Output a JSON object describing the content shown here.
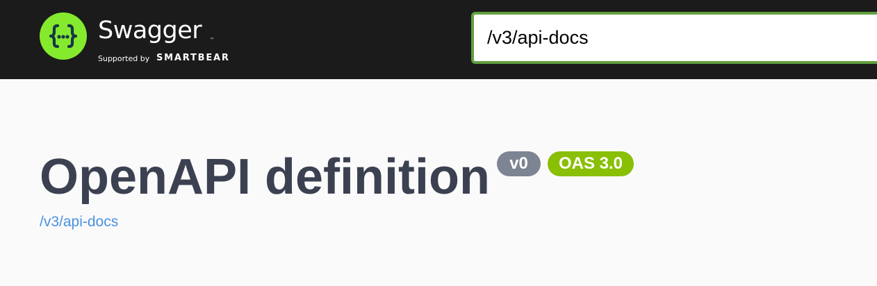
{
  "topbar": {
    "logo": {
      "icon": "swagger-braces-icon",
      "brand_name": "Swagger",
      "trademark": "™",
      "supported_by": "Supported by",
      "company": "SMARTBEAR"
    },
    "url_input": {
      "value": "/v3/api-docs"
    }
  },
  "info": {
    "title": "OpenAPI definition",
    "version_badge": "v0",
    "oas_badge": "OAS 3.0",
    "spec_link": "/v3/api-docs"
  },
  "colors": {
    "topbar_bg": "#1b1b1b",
    "logo_green": "#85ea2d",
    "input_border": "#62a03f",
    "title": "#3b4151",
    "version_badge": "#7d8492",
    "oas_badge": "#89bf04",
    "link": "#4990e2",
    "page_bg": "#fafafa"
  }
}
